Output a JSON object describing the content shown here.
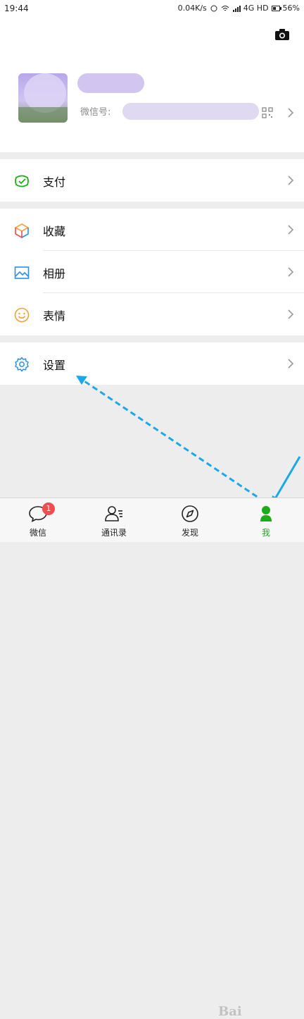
{
  "status_bar": {
    "time": "19:44",
    "speed": "0.04K/s",
    "network": "4G HD",
    "battery": "56%",
    "battery_level": 0.56
  },
  "profile": {
    "wechat_id_label": "微信号:"
  },
  "menu": {
    "pay": "支付",
    "favorites": "收藏",
    "album": "相册",
    "stickers": "表情",
    "settings": "设置"
  },
  "tabs": {
    "chats": "微信",
    "chats_badge": "1",
    "contacts": "通讯录",
    "discover": "发现",
    "me": "我"
  },
  "colors": {
    "accent_green": "#1aad19",
    "badge_red": "#f04e4e",
    "arrow_blue": "#19a9e8"
  },
  "watermark": "Bai"
}
